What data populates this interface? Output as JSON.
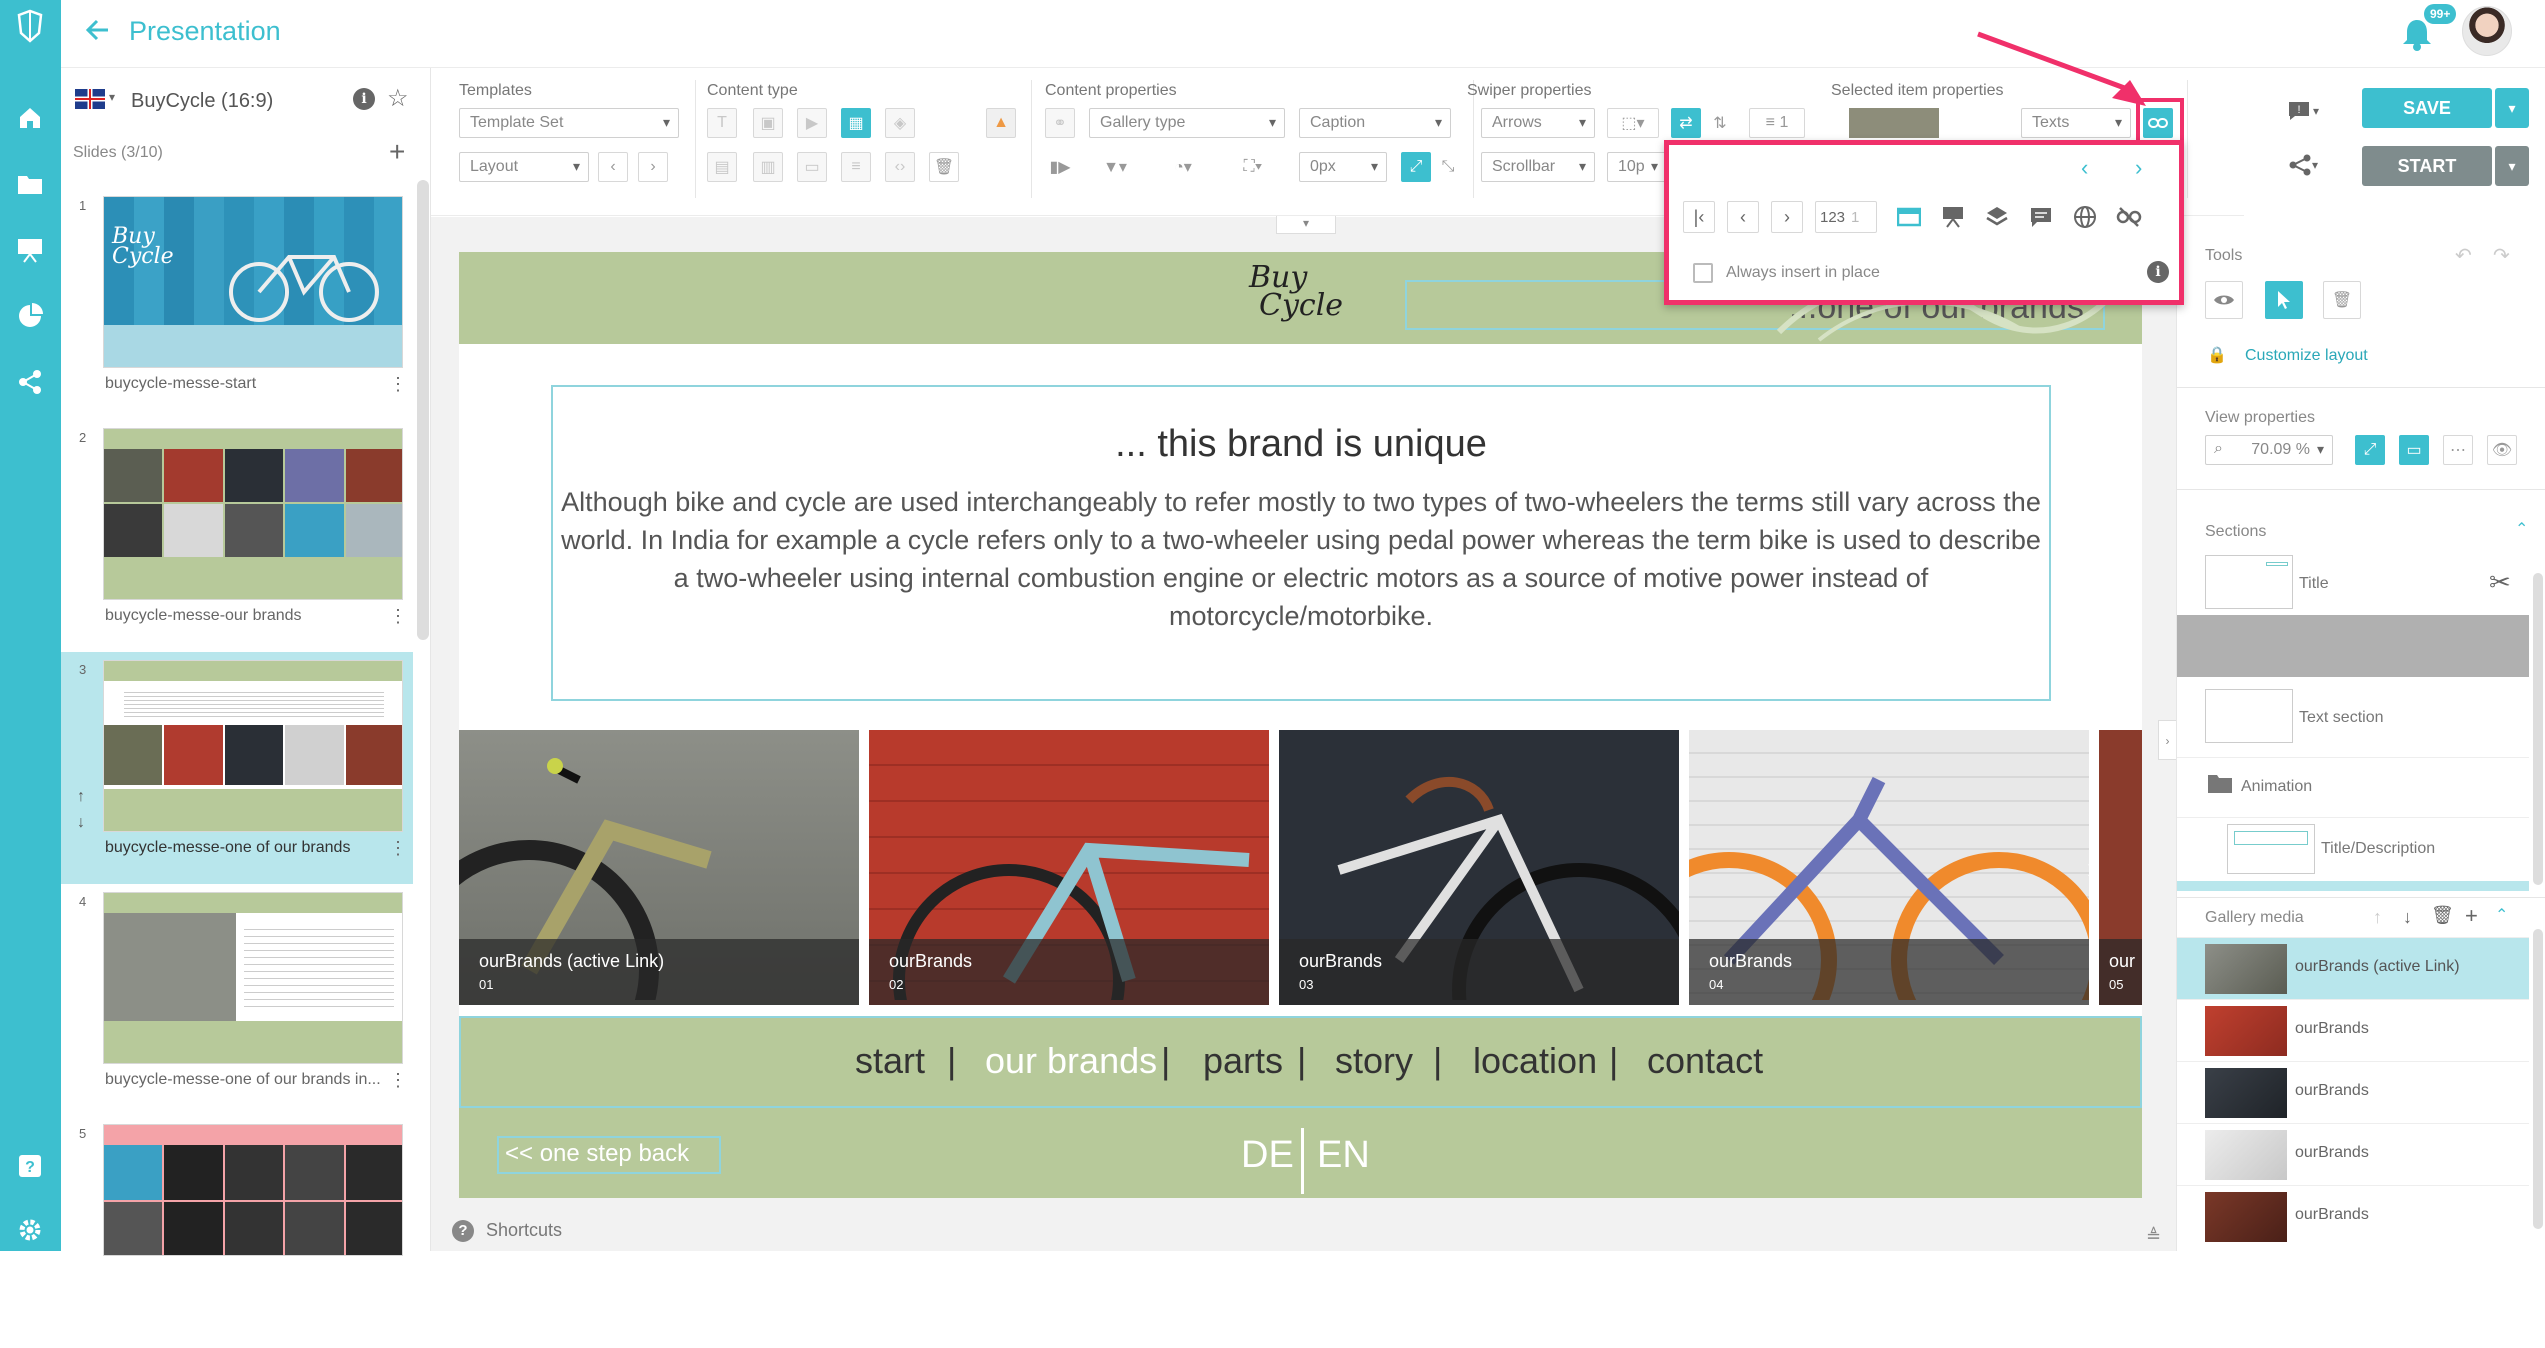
{
  "app": {
    "title": "Presentation",
    "notification_count": "99+"
  },
  "colors": {
    "accent": "#3dbfcf",
    "slide_green": "#b7c99a",
    "highlight": "#f0306a",
    "button_grey": "#7f8c8d"
  },
  "rail_icons": [
    "logo-icon",
    "home-icon",
    "folder-icon",
    "presentation-icon",
    "pie-chart-icon",
    "share-icon",
    "help-icon",
    "settings-icon"
  ],
  "slides_panel": {
    "language": "EN",
    "presentation_name": "BuyCycle (16:9)",
    "slides_count": "Slides (3/10)",
    "slides": [
      {
        "num": "1",
        "name": "buycycle-messe-start"
      },
      {
        "num": "2",
        "name": "buycycle-messe-our brands"
      },
      {
        "num": "3",
        "name": "buycycle-messe-one of our brands"
      },
      {
        "num": "4",
        "name": "buycycle-messe-one of our brands in..."
      },
      {
        "num": "5",
        "name": ""
      }
    ]
  },
  "toolbar": {
    "groups": {
      "templates": "Templates",
      "content_type": "Content type",
      "content_properties": "Content properties",
      "swiper_properties": "Swiper properties",
      "selected_item_properties": "Selected item properties"
    },
    "template_set": "Template Set",
    "layout": "Layout",
    "gallery_type": "Gallery type",
    "caption": "Caption",
    "arrows": "Arrows",
    "scrollbar": "Scrollbar",
    "spacing": "0px",
    "texts": "Texts",
    "count": "1",
    "size_partial": "10p",
    "save": "SAVE",
    "start": "START"
  },
  "popup": {
    "number_field": "123",
    "number_value": "1",
    "always_insert_label": "Always insert in place"
  },
  "slide": {
    "logo_line1": "Buy",
    "logo_line2": "Cycle",
    "header_subtitle": "...one of our brands",
    "title": "... this brand is unique",
    "body": "Although bike and cycle are used interchangeably to refer mostly to two types of two-wheelers the terms still vary across the world. In India for example a cycle refers only to a two-wheeler using pedal power whereas the term bike is used to describe a two-wheeler using internal combustion engine or electric motors as a source of motive power instead of motorcycle/motorbike.",
    "gallery": [
      {
        "title": "ourBrands (active Link)",
        "num": "01"
      },
      {
        "title": "ourBrands",
        "num": "02"
      },
      {
        "title": "ourBrands",
        "num": "03"
      },
      {
        "title": "ourBrands",
        "num": "04"
      },
      {
        "title": "our",
        "num": "05"
      }
    ],
    "nav": [
      "start",
      "our brands",
      "parts",
      "story",
      "location",
      "contact"
    ],
    "nav_separator": "|",
    "back": "<< one step back",
    "lang_de": "DE",
    "lang_en": "EN"
  },
  "right_panel": {
    "tools": "Tools",
    "customize_layout": "Customize layout",
    "view_properties": "View properties",
    "zoom": "70.09 %",
    "sections": "Sections",
    "section_items": [
      "Title",
      "Text section",
      "Animation",
      "Title/Description"
    ],
    "gallery_media": "Gallery media",
    "media_items": [
      "ourBrands (active Link)",
      "ourBrands",
      "ourBrands",
      "ourBrands",
      "ourBrands"
    ]
  },
  "footer": {
    "shortcuts": "Shortcuts"
  }
}
